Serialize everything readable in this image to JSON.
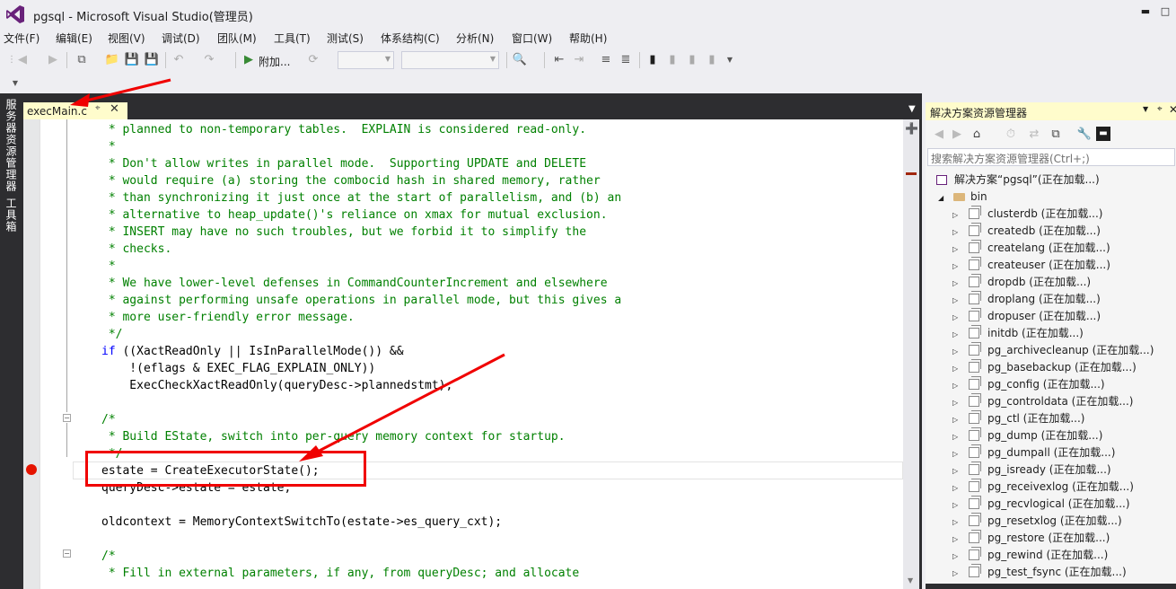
{
  "window": {
    "title": "pgsql - Microsoft Visual Studio(管理员)",
    "logo_icon": "visual-studio-logo-icon",
    "accent_color": "#68217a"
  },
  "menu": [
    "文件(F)",
    "编辑(E)",
    "视图(V)",
    "调试(D)",
    "团队(M)",
    "工具(T)",
    "测试(S)",
    "体系结构(C)",
    "分析(N)",
    "窗口(W)",
    "帮助(H)"
  ],
  "toolbar": {
    "attach_label": "附加..."
  },
  "left_tools": [
    "服务器资源管理器",
    "工具箱"
  ],
  "editor": {
    "tab_title": "execMain.c",
    "lines": [
      {
        "text": " * planned to non-temporary tables.  EXPLAIN is considered read-only.",
        "style": "cm"
      },
      {
        "text": " *",
        "style": "cm"
      },
      {
        "text": " * Don't allow writes in parallel mode.  Supporting UPDATE and DELETE",
        "style": "cm"
      },
      {
        "text": " * would require (a) storing the combocid hash in shared memory, rather",
        "style": "cm"
      },
      {
        "text": " * than synchronizing it just once at the start of parallelism, and (b) an",
        "style": "cm"
      },
      {
        "text": " * alternative to heap_update()'s reliance on xmax for mutual exclusion.",
        "style": "cm"
      },
      {
        "text": " * INSERT may have no such troubles, but we forbid it to simplify the",
        "style": "cm"
      },
      {
        "text": " * checks.",
        "style": "cm"
      },
      {
        "text": " *",
        "style": "cm"
      },
      {
        "text": " * We have lower-level defenses in CommandCounterIncrement and elsewhere",
        "style": "cm"
      },
      {
        "text": " * against performing unsafe operations in parallel mode, but this gives a",
        "style": "cm"
      },
      {
        "text": " * more user-friendly error message.",
        "style": "cm"
      },
      {
        "text": " */",
        "style": "cm"
      },
      {
        "kw": "if",
        "text": " ((XactReadOnly || IsInParallelMode()) &&",
        "style": "tx"
      },
      {
        "text": "    !(eflags & EXEC_FLAG_EXPLAIN_ONLY))",
        "style": "tx"
      },
      {
        "text": "    ExecCheckXactReadOnly(queryDesc->plannedstmt);",
        "style": "tx"
      },
      {
        "text": "",
        "style": "tx"
      },
      {
        "text": "/*",
        "style": "cm"
      },
      {
        "text": " * Build EState, switch into per-query memory context for startup.",
        "style": "cm"
      },
      {
        "text": " */",
        "style": "cm"
      },
      {
        "text": "estate = CreateExecutorState();",
        "style": "tx"
      },
      {
        "text": "queryDesc->estate = estate;",
        "style": "tx"
      },
      {
        "text": "",
        "style": "tx"
      },
      {
        "text": "oldcontext = MemoryContextSwitchTo(estate->es_query_cxt);",
        "style": "tx"
      },
      {
        "text": "",
        "style": "tx"
      },
      {
        "text": "/*",
        "style": "cm"
      },
      {
        "text": " * Fill in external parameters, if any, from queryDesc; and allocate",
        "style": "cm"
      }
    ]
  },
  "solution_explorer": {
    "title": "解决方案资源管理器",
    "search_placeholder": "搜索解决方案资源管理器(Ctrl+;)",
    "solution_label": "解决方案“pgsql”(正在加载...)",
    "folder_label": "bin",
    "projects": [
      "clusterdb (正在加载...)",
      "createdb (正在加载...)",
      "createlang (正在加载...)",
      "createuser (正在加载...)",
      "dropdb (正在加载...)",
      "droplang (正在加载...)",
      "dropuser (正在加载...)",
      "initdb (正在加载...)",
      "pg_archivecleanup (正在加载...)",
      "pg_basebackup (正在加载...)",
      "pg_config (正在加载...)",
      "pg_controldata (正在加载...)",
      "pg_ctl (正在加载...)",
      "pg_dump (正在加载...)",
      "pg_dumpall (正在加载...)",
      "pg_isready (正在加载...)",
      "pg_receivexlog (正在加载...)",
      "pg_recvlogical (正在加载...)",
      "pg_resetxlog (正在加载...)",
      "pg_restore (正在加载...)",
      "pg_rewind (正在加载...)",
      "pg_test_fsync (正在加载...)"
    ]
  },
  "annotations": {
    "highlight_color": "#f00000"
  }
}
